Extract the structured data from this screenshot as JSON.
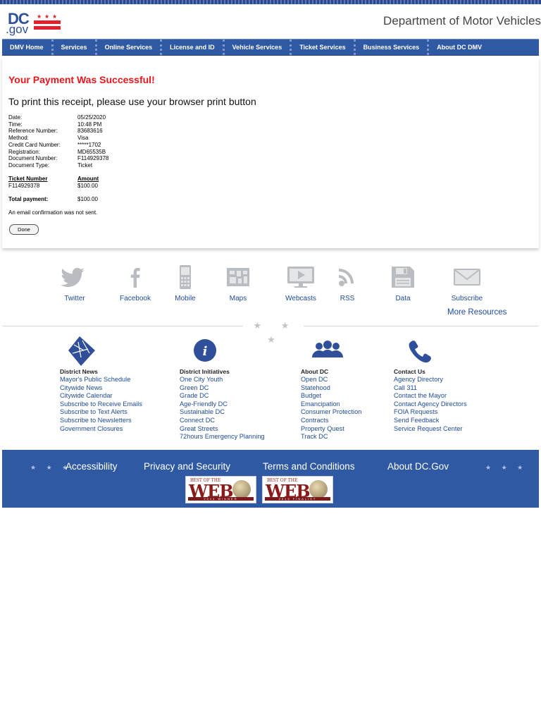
{
  "header": {
    "logo_dc": "DC",
    "logo_gov": ".gov",
    "agency_title": "Department of Motor Vehicles"
  },
  "nav": {
    "items": [
      "DMV Home",
      "Services",
      "Online Services",
      "License and ID",
      "Vehicle Services",
      "Ticket Services",
      "Business Services",
      "About DC DMV"
    ]
  },
  "receipt": {
    "success_message": "Your Payment Was Successful!",
    "print_message": "To print this receipt, please use your browser print button",
    "fields": [
      {
        "label": "Date:",
        "value": "05/25/2020"
      },
      {
        "label": "Time:",
        "value": "10:48 PM"
      },
      {
        "label": "Reference Number:",
        "value": "83683616"
      },
      {
        "label": "Method:",
        "value": "Visa"
      },
      {
        "label": "Credit Card Number:",
        "value": "*****1702"
      },
      {
        "label": "Registration:",
        "value": "MD65535B"
      },
      {
        "label": "Document Number:",
        "value": "F114929378"
      },
      {
        "label": "Document Type:",
        "value": "Ticket"
      }
    ],
    "ticket_header": "Ticket Number",
    "amount_header": "Amount",
    "ticket_number": "F114929378",
    "ticket_amount": "$100.00",
    "total_label": "Total payment:",
    "total_value": "$100.00",
    "email_note": "An email confirmation was not sent.",
    "done_label": "Done"
  },
  "social": {
    "items": [
      {
        "label": "Twitter",
        "icon": "twitter-icon"
      },
      {
        "label": "Facebook",
        "icon": "facebook-icon"
      },
      {
        "label": "Mobile",
        "icon": "mobile-icon"
      },
      {
        "label": "Maps",
        "icon": "maps-icon"
      },
      {
        "label": "Webcasts",
        "icon": "webcasts-icon"
      },
      {
        "label": "RSS",
        "icon": "rss-icon"
      },
      {
        "label": "Data",
        "icon": "data-icon"
      },
      {
        "label": "Subscribe",
        "icon": "subscribe-icon"
      }
    ],
    "more_resources": "More Resources",
    "divider_stars": "★ ★ ★"
  },
  "columns": [
    {
      "heading": "District News",
      "icon": "dc-map-icon",
      "links": [
        "Mayor's Public Schedule",
        "Citywide News",
        "Citywide Calendar",
        "Subscribe to Receive Emails",
        "Subscribe to Text Alerts",
        "Subscribe to Newsletters",
        "Government Closures"
      ]
    },
    {
      "heading": "District Initiatives",
      "icon": "info-icon",
      "links": [
        "One City Youth",
        "Green DC",
        "Grade DC",
        "Age-Friendly DC",
        "Sustainable DC",
        "Connect DC",
        "Great Streets",
        "72hours Emergency Planning"
      ]
    },
    {
      "heading": "About DC",
      "icon": "people-icon",
      "links": [
        "Open DC",
        "Statehood",
        "Budget",
        "Emancipation",
        "Consumer Protection",
        "Contracts",
        "Property Quest",
        "Track DC"
      ]
    },
    {
      "heading": "Contact Us",
      "icon": "phone-icon",
      "links": [
        "Agency Directory",
        "Call 311",
        "Contact the Mayor",
        "Contact Agency Directors",
        "FOIA Requests",
        "Send Feedback",
        "Service Request Center"
      ]
    }
  ],
  "footer": {
    "links": [
      "Accessibility",
      "Privacy and Security",
      "Terms and Conditions",
      "About DC.Gov"
    ],
    "stars": "★ ★ ★",
    "awards": [
      {
        "top": "BEST OF THE",
        "main": "WEB",
        "band": "2014 WINNER"
      },
      {
        "top": "BEST OF THE",
        "main": "WEB",
        "band": "2013 FINALIST"
      }
    ]
  },
  "colors": {
    "nav_blue": "#2f5aa3",
    "success_red": "#e8151a",
    "link_blue": "#1d4a99"
  }
}
